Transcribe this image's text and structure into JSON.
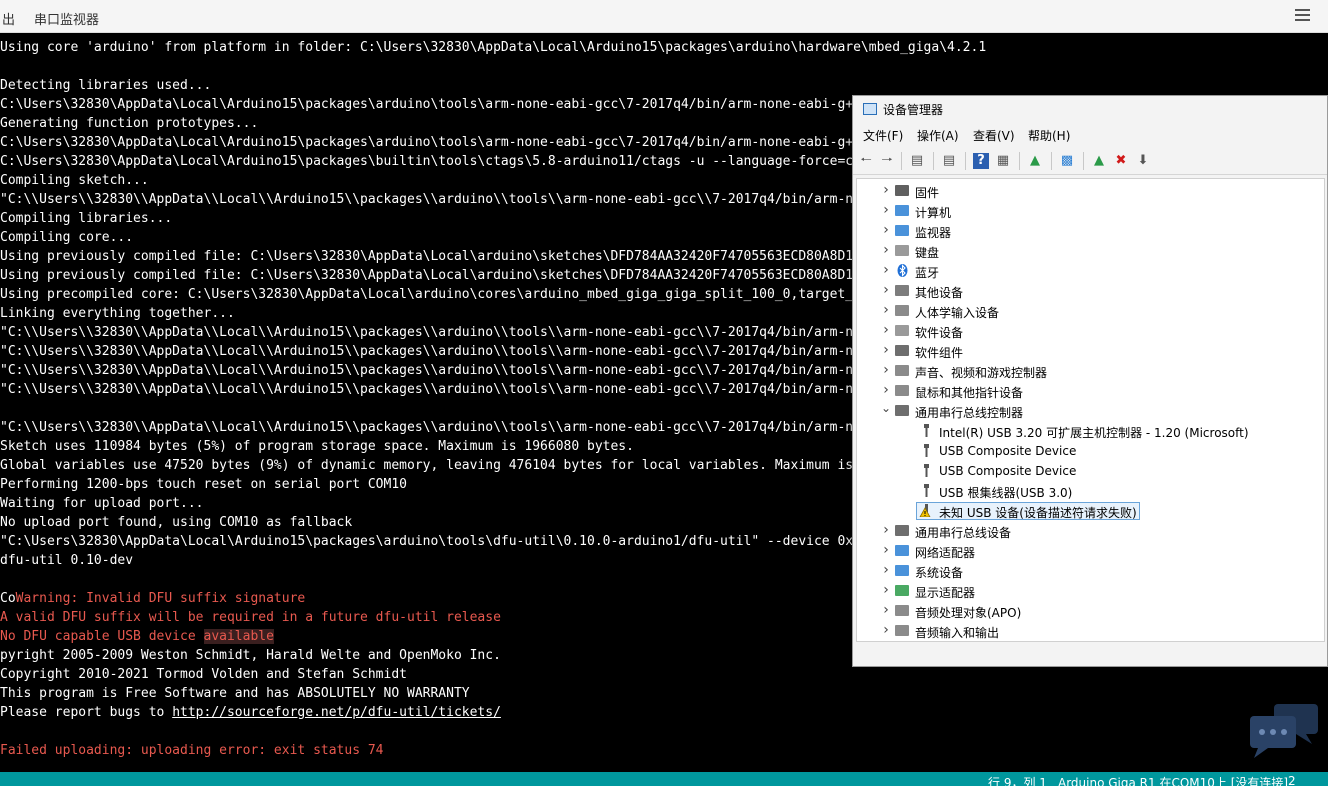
{
  "ide": {
    "tabs": [
      {
        "label": "出"
      },
      {
        "label": "串口监视器"
      }
    ],
    "status": {
      "line_col": "行 9，列 1",
      "board": "Arduino Giga R1 在COM10上 [没有连接]",
      "notifications": "2"
    }
  },
  "console": {
    "lines": [
      [
        {
          "t": "Using core 'arduino' from platform in folder: C:\\Users\\32830\\AppData\\Local\\Arduino15\\packages\\arduino\\hardware\\mbed_giga\\4.2.1"
        }
      ],
      [],
      [
        {
          "t": "Detecting libraries used..."
        }
      ],
      [
        {
          "t": "C:\\Users\\32830\\AppData\\Local\\Arduino15\\packages\\arduino\\tools\\arm-none-eabi-gcc\\7-2017q4/bin/arm-none-eabi-g++"
        }
      ],
      [
        {
          "t": "Generating function prototypes..."
        }
      ],
      [
        {
          "t": "C:\\Users\\32830\\AppData\\Local\\Arduino15\\packages\\arduino\\tools\\arm-none-eabi-gcc\\7-2017q4/bin/arm-none-eabi-g++"
        }
      ],
      [
        {
          "t": "C:\\Users\\32830\\AppData\\Local\\Arduino15\\packages\\builtin\\tools\\ctags\\5.8-arduino11/ctags -u --language-force=c++"
        }
      ],
      [
        {
          "t": "Compiling sketch..."
        }
      ],
      [
        {
          "t": "\"C:\\\\Users\\\\32830\\\\AppData\\\\Local\\\\Arduino15\\\\packages\\\\arduino\\\\tools\\\\arm-none-eabi-gcc\\\\7-2017q4/bin/arm-non"
        }
      ],
      [
        {
          "t": "Compiling libraries..."
        }
      ],
      [
        {
          "t": "Compiling core..."
        }
      ],
      [
        {
          "t": "Using previously compiled file: C:\\Users\\32830\\AppData\\Local\\arduino\\sketches\\DFD784AA32420F74705563ECD80A8D15\\"
        }
      ],
      [
        {
          "t": "Using previously compiled file: C:\\Users\\32830\\AppData\\Local\\arduino\\sketches\\DFD784AA32420F74705563ECD80A8D15\\"
        }
      ],
      [
        {
          "t": "Using precompiled core: C:\\Users\\32830\\AppData\\Local\\arduino\\cores\\arduino_mbed_giga_giga_split_100_0,target_co"
        }
      ],
      [
        {
          "t": "Linking everything together..."
        }
      ],
      [
        {
          "t": "\"C:\\\\Users\\\\32830\\\\AppData\\\\Local\\\\Arduino15\\\\packages\\\\arduino\\\\tools\\\\arm-none-eabi-gcc\\\\7-2017q4/bin/arm-non"
        }
      ],
      [
        {
          "t": "\"C:\\\\Users\\\\32830\\\\AppData\\\\Local\\\\Arduino15\\\\packages\\\\arduino\\\\tools\\\\arm-none-eabi-gcc\\\\7-2017q4/bin/arm-non"
        }
      ],
      [
        {
          "t": "\"C:\\\\Users\\\\32830\\\\AppData\\\\Local\\\\Arduino15\\\\packages\\\\arduino\\\\tools\\\\arm-none-eabi-gcc\\\\7-2017q4/bin/arm-non"
        }
      ],
      [
        {
          "t": "\"C:\\\\Users\\\\32830\\\\AppData\\\\Local\\\\Arduino15\\\\packages\\\\arduino\\\\tools\\\\arm-none-eabi-gcc\\\\7-2017q4/bin/arm-non"
        }
      ],
      [],
      [
        {
          "t": "\"C:\\\\Users\\\\32830\\\\AppData\\\\Local\\\\Arduino15\\\\packages\\\\arduino\\\\tools\\\\arm-none-eabi-gcc\\\\7-2017q4/bin/arm-non"
        }
      ],
      [
        {
          "t": "Sketch uses 110984 bytes (5%) of program storage space. Maximum is 1966080 bytes."
        }
      ],
      [
        {
          "t": "Global variables use 47520 bytes (9%) of dynamic memory, leaving 476104 bytes for local variables. Maximum is 5"
        }
      ],
      [
        {
          "t": "Performing 1200-bps touch reset on serial port COM10"
        }
      ],
      [
        {
          "t": "Waiting for upload port..."
        }
      ],
      [
        {
          "t": "No upload port found, using COM10 as fallback"
        }
      ],
      [
        {
          "t": "\"C:\\Users\\32830\\AppData\\Local\\Arduino15\\packages\\arduino\\tools\\dfu-util\\0.10.0-arduino1/dfu-util\" --device 0x23"
        }
      ],
      [
        {
          "t": "dfu-util 0.10-dev"
        }
      ],
      [],
      [
        {
          "t": "Co"
        },
        {
          "t": "Warning: Invalid DFU suffix signature",
          "c": "w"
        }
      ],
      [
        {
          "t": "A valid DFU suffix will be required in a future dfu-util release",
          "c": "w"
        }
      ],
      [
        {
          "t": "No DFU capable USB device ",
          "c": "w"
        },
        {
          "t": "available",
          "c": "w hl"
        }
      ],
      [
        {
          "t": "pyright 2005-2009 Weston Schmidt, Harald Welte and OpenMoko Inc."
        }
      ],
      [
        {
          "t": "Copyright 2010-2021 Tormod Volden and Stefan Schmidt"
        }
      ],
      [
        {
          "t": "This program is Free Software and has ABSOLUTELY NO WARRANTY"
        }
      ],
      [
        {
          "t": "Please report bugs to "
        },
        {
          "t": "http://sourceforge.net/p/dfu-util/tickets/",
          "c": "link"
        }
      ],
      [],
      [
        {
          "t": "Failed uploading: uploading error: exit status 74",
          "c": "w"
        }
      ]
    ]
  },
  "device_manager": {
    "title": "设备管理器",
    "menu": [
      "文件(F)",
      "操作(A)",
      "查看(V)",
      "帮助(H)"
    ],
    "tree": [
      {
        "label": "固件",
        "icon": "firmware-icon",
        "color": "#444444",
        "expanded": false,
        "level": 0
      },
      {
        "label": "计算机",
        "icon": "computer-icon",
        "color": "#2a7fd4",
        "expanded": false,
        "level": 0
      },
      {
        "label": "监视器",
        "icon": "monitor-icon",
        "color": "#2a7fd4",
        "expanded": false,
        "level": 0
      },
      {
        "label": "键盘",
        "icon": "keyboard-icon",
        "color": "#888888",
        "expanded": false,
        "level": 0
      },
      {
        "label": "蓝牙",
        "icon": "bluetooth-icon",
        "color": "#1f6fd6",
        "expanded": false,
        "level": 0
      },
      {
        "label": "其他设备",
        "icon": "other-devices-icon",
        "color": "#666666",
        "expanded": false,
        "level": 0
      },
      {
        "label": "人体学输入设备",
        "icon": "hid-icon",
        "color": "#777777",
        "expanded": false,
        "level": 0
      },
      {
        "label": "软件设备",
        "icon": "software-device-icon",
        "color": "#888888",
        "expanded": false,
        "level": 0
      },
      {
        "label": "软件组件",
        "icon": "software-component-icon",
        "color": "#555555",
        "expanded": false,
        "level": 0
      },
      {
        "label": "声音、视频和游戏控制器",
        "icon": "speaker-icon",
        "color": "#777777",
        "expanded": false,
        "level": 0
      },
      {
        "label": "鼠标和其他指针设备",
        "icon": "mouse-icon",
        "color": "#777777",
        "expanded": false,
        "level": 0
      },
      {
        "label": "通用串行总线控制器",
        "icon": "usb-controller-icon",
        "color": "#555555",
        "expanded": true,
        "level": 0
      },
      {
        "label": "Intel(R) USB 3.20 可扩展主机控制器 - 1.20 (Microsoft)",
        "icon": "usb-plug-icon",
        "color": "#555555",
        "level": 1
      },
      {
        "label": "USB Composite Device",
        "icon": "usb-plug-icon",
        "color": "#555555",
        "level": 1
      },
      {
        "label": "USB Composite Device",
        "icon": "usb-plug-icon",
        "color": "#555555",
        "level": 1
      },
      {
        "label": "USB 根集线器(USB 3.0)",
        "icon": "usb-plug-icon",
        "color": "#555555",
        "level": 1
      },
      {
        "label": "未知 USB 设备(设备描述符请求失败)",
        "icon": "warning-usb-icon",
        "color": "#e0a800",
        "level": 1,
        "selected": true
      },
      {
        "label": "通用串行总线设备",
        "icon": "usb-device-icon",
        "color": "#555555",
        "expanded": false,
        "level": 0
      },
      {
        "label": "网络适配器",
        "icon": "network-adapter-icon",
        "color": "#2a7fd4",
        "expanded": false,
        "level": 0
      },
      {
        "label": "系统设备",
        "icon": "system-device-icon",
        "color": "#2a7fd4",
        "expanded": false,
        "level": 0
      },
      {
        "label": "显示适配器",
        "icon": "display-adapter-icon",
        "color": "#2a9a48",
        "expanded": false,
        "level": 0
      },
      {
        "label": "音频处理对象(APO)",
        "icon": "audio-processing-icon",
        "color": "#777777",
        "expanded": false,
        "level": 0
      },
      {
        "label": "音频输入和输出",
        "icon": "audio-io-icon",
        "color": "#777777",
        "expanded": false,
        "level": 0
      }
    ]
  }
}
